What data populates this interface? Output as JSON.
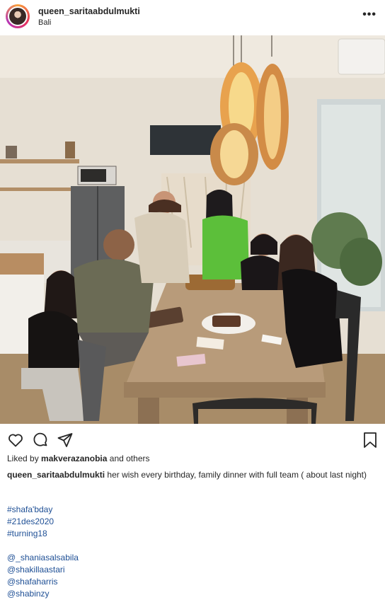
{
  "post": {
    "username": "queen_saritaabdulmukti",
    "location": "Bali",
    "more_label": "•••"
  },
  "photo": {
    "description_icon": "photo-image"
  },
  "actions": {
    "like_icon": "heart-icon",
    "comment_icon": "comment-icon",
    "share_icon": "send-icon",
    "save_icon": "bookmark-icon"
  },
  "likes": {
    "prefix": "Liked by",
    "user": "makverazanobia",
    "suffix": "and others"
  },
  "caption": {
    "username": "queen_saritaabdulmukti",
    "text": "her wish every birthday, family dinner with full team ( about last night)"
  },
  "hashtags": [
    "#shafa'bday",
    "#21des2020",
    "#turning18"
  ],
  "mentions": [
    "@_shaniasalsabila",
    "@shakillaastari",
    "@shafaharris",
    "@shabinzy"
  ],
  "colors": {
    "link": "#1e4f95",
    "text": "#262626"
  }
}
